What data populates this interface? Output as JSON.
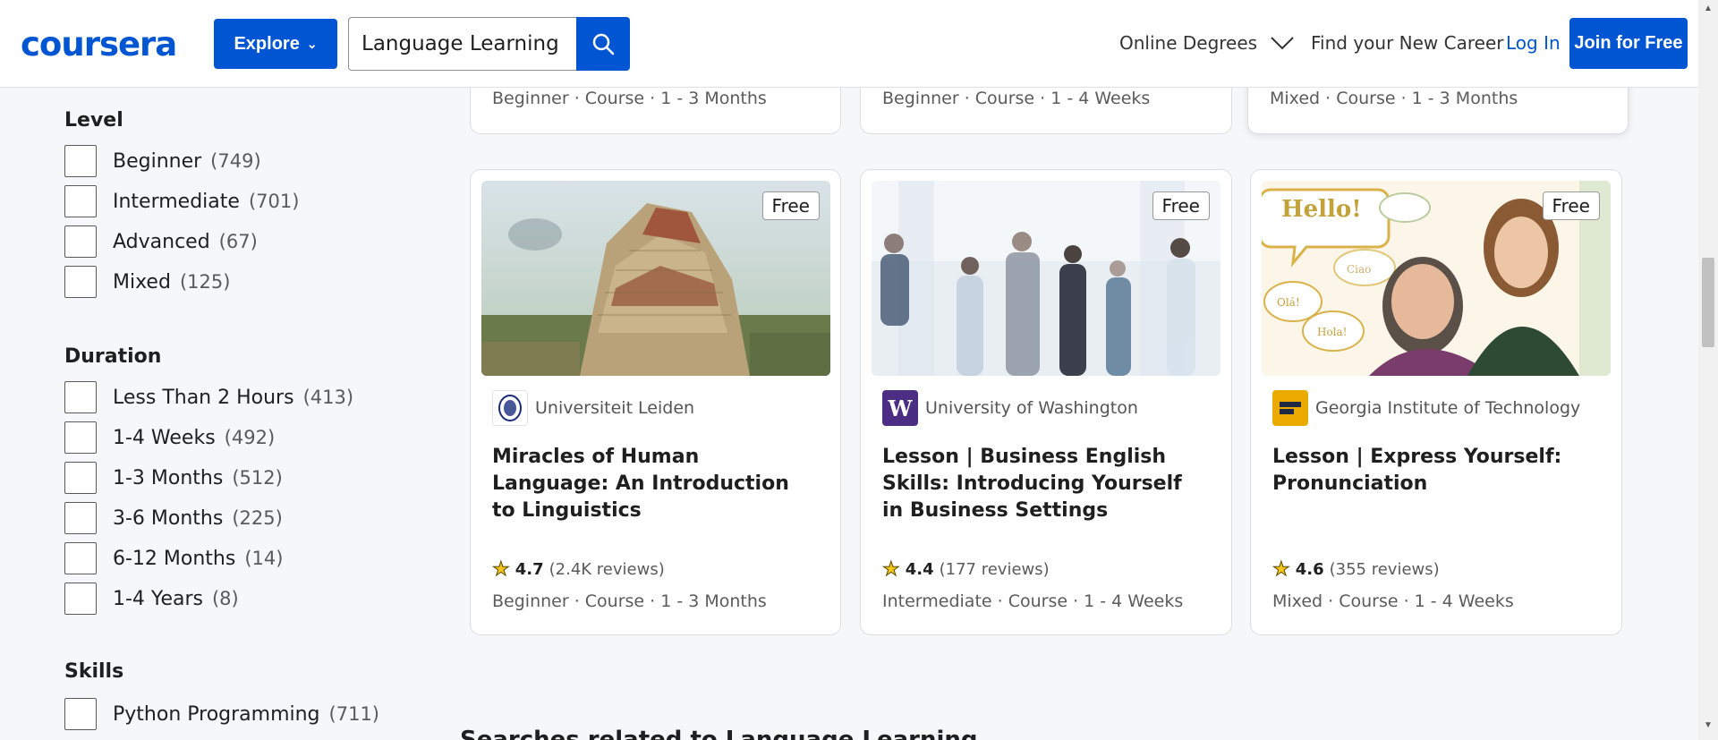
{
  "header": {
    "logo": "coursera",
    "explore_label": "Explore",
    "search_value": "Language Learning",
    "nav_degrees": "Online Degrees",
    "nav_career": "Find your New Career",
    "login": "Log In",
    "join": "Join for Free",
    "brand_color": "#0056d2"
  },
  "filters": {
    "level": {
      "heading": "Level",
      "items": [
        {
          "label": "Beginner",
          "count": "(749)"
        },
        {
          "label": "Intermediate",
          "count": "(701)"
        },
        {
          "label": "Advanced",
          "count": "(67)"
        },
        {
          "label": "Mixed",
          "count": "(125)"
        }
      ]
    },
    "duration": {
      "heading": "Duration",
      "items": [
        {
          "label": "Less Than 2 Hours",
          "count": "(413)"
        },
        {
          "label": "1-4 Weeks",
          "count": "(492)"
        },
        {
          "label": "1-3 Months",
          "count": "(512)"
        },
        {
          "label": "3-6 Months",
          "count": "(225)"
        },
        {
          "label": "6-12 Months",
          "count": "(14)"
        },
        {
          "label": "1-4 Years",
          "count": "(8)"
        }
      ]
    },
    "skills": {
      "heading": "Skills",
      "items": [
        {
          "label": "Python Programming",
          "count": "(711)"
        }
      ]
    }
  },
  "top_cards": [
    {
      "meta": "Beginner · Course · 1 - 3 Months"
    },
    {
      "meta": "Beginner · Course · 1 - 4 Weeks"
    },
    {
      "meta": "Mixed · Course · 1 - 3 Months"
    }
  ],
  "cards": [
    {
      "badge": "Free",
      "partner": "Universiteit Leiden",
      "title": "Miracles of Human Language: An Introduction to Linguistics",
      "score": "4.7",
      "reviews": "(2.4K reviews)",
      "meta": "Beginner · Course · 1 - 3 Months"
    },
    {
      "badge": "Free",
      "partner": "University of Washington",
      "title": "Lesson | Business English Skills: Introducing Yourself in Business Settings",
      "score": "4.4",
      "reviews": "(177 reviews)",
      "meta": "Intermediate · Course · 1 - 4 Weeks"
    },
    {
      "badge": "Free",
      "partner": "Georgia Institute of Technology",
      "title": "Lesson | Express Yourself: Pronunciation",
      "score": "4.6",
      "reviews": "(355 reviews)",
      "meta": "Mixed · Course · 1 - 4 Weeks",
      "image_text": [
        "Hello!",
        "Ciao",
        "Olá!",
        "Hola!"
      ]
    }
  ],
  "related_heading": "Searches related to Language Learning"
}
